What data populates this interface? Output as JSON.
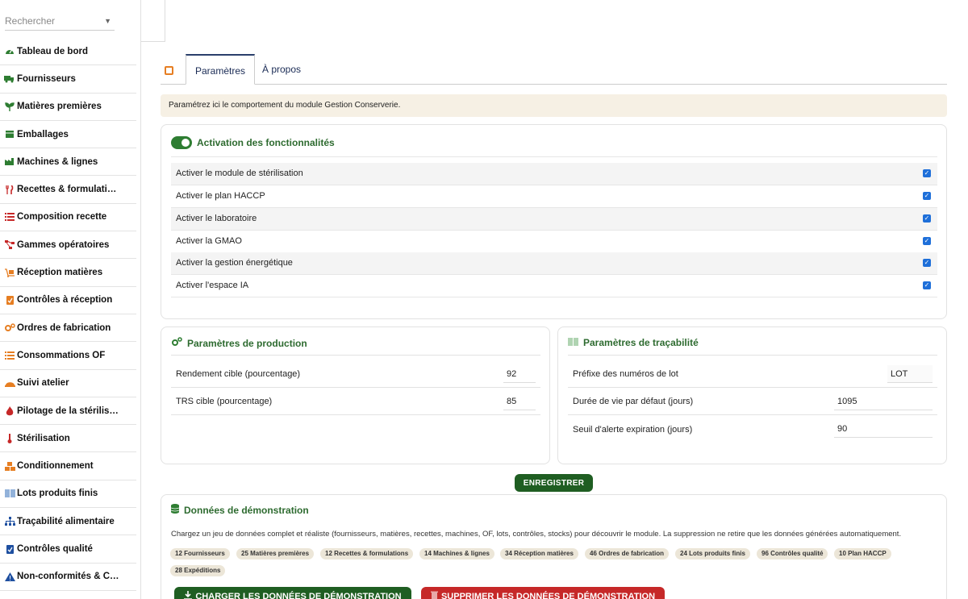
{
  "sidebar": {
    "search_placeholder": "Rechercher",
    "items": [
      {
        "label": "Tableau de bord",
        "icon": "gauge-icon"
      },
      {
        "label": "Fournisseurs",
        "icon": "truck-icon"
      },
      {
        "label": "Matières premières",
        "icon": "seedling-icon"
      },
      {
        "label": "Emballages",
        "icon": "box-icon"
      },
      {
        "label": "Machines & lignes",
        "icon": "industry-icon"
      },
      {
        "label": "Recettes & formulati…",
        "icon": "utensils-icon"
      },
      {
        "label": "Composition recette",
        "icon": "list-icon"
      },
      {
        "label": "Gammes opératoires",
        "icon": "flow-icon"
      },
      {
        "label": "Réception matières",
        "icon": "dolly-icon"
      },
      {
        "label": "Contrôles à réception",
        "icon": "clipboard-check-icon"
      },
      {
        "label": "Ordres de fabrication",
        "icon": "cogs-icon"
      },
      {
        "label": "Consommations OF",
        "icon": "list-icon"
      },
      {
        "label": "Suivi atelier",
        "icon": "hardhat-icon"
      },
      {
        "label": "Pilotage de la stérilis…",
        "icon": "fire-icon"
      },
      {
        "label": "Stérilisation",
        "icon": "thermometer-icon"
      },
      {
        "label": "Conditionnement",
        "icon": "boxes-icon"
      },
      {
        "label": "Lots produits finis",
        "icon": "barcode-icon"
      },
      {
        "label": "Traçabilité alimentaire",
        "icon": "sitemap-icon"
      },
      {
        "label": "Contrôles qualité",
        "icon": "clipboard-check-icon"
      },
      {
        "label": "Non-conformités & C…",
        "icon": "warning-icon"
      }
    ]
  },
  "tabs": {
    "settings": "Paramètres",
    "about": "À propos"
  },
  "info_text": "Paramétrez ici le comportement du module Gestion Conserverie.",
  "features": {
    "title": "Activation des fonctionnalités",
    "rows": [
      {
        "label": "Activer le module de stérilisation",
        "checked": true
      },
      {
        "label": "Activer le plan HACCP",
        "checked": true
      },
      {
        "label": "Activer le laboratoire",
        "checked": true
      },
      {
        "label": "Activer la GMAO",
        "checked": true
      },
      {
        "label": "Activer la gestion énergétique",
        "checked": true
      },
      {
        "label": "Activer l'espace IA",
        "checked": true
      }
    ]
  },
  "production": {
    "title": "Paramètres de production",
    "rows": [
      {
        "label": "Rendement cible (pourcentage)",
        "value": "92"
      },
      {
        "label": "TRS cible (pourcentage)",
        "value": "85"
      }
    ]
  },
  "traceability": {
    "title": "Paramètres de traçabilité",
    "rows": [
      {
        "label": "Préfixe des numéros de lot",
        "value": "LOT"
      },
      {
        "label": "Durée de vie par défaut (jours)",
        "value": "1095"
      },
      {
        "label": "Seuil d'alerte expiration (jours)",
        "value": "90"
      }
    ]
  },
  "save_button": "ENREGISTRER",
  "demo": {
    "title": "Données de démonstration",
    "description": "Chargez un jeu de données complet et réaliste (fournisseurs, matières, recettes, machines, OF, lots, contrôles, stocks) pour découvrir le module. La suppression ne retire que les données générées automatiquement.",
    "chips": [
      "12 Fournisseurs",
      "25 Matières premières",
      "12 Recettes & formulations",
      "14 Machines & lignes",
      "34 Réception matières",
      "46 Ordres de fabrication",
      "24 Lots produits finis",
      "96 Contrôles qualité",
      "10 Plan HACCP",
      "28 Expéditions"
    ],
    "load_button": "CHARGER LES DONNÉES DE DÉMONSTRATION",
    "delete_button": "SUPPRIMER LES DONNÉES DE DÉMONSTRATION"
  },
  "colors": {
    "accent_green": "#2e7d32",
    "danger_red": "#c62828",
    "tab_accent": "#2a3f6b"
  }
}
